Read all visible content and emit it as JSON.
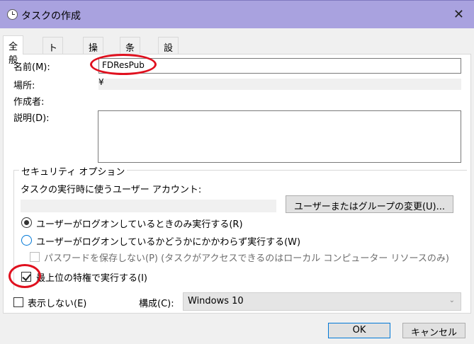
{
  "window": {
    "title": "タスクの作成",
    "close_icon": "close-icon",
    "app_icon": "clock-icon"
  },
  "tabs": [
    {
      "label": "全般"
    },
    {
      "label": "トリガー"
    },
    {
      "label": "操作"
    },
    {
      "label": "条件"
    },
    {
      "label": "設定"
    }
  ],
  "general": {
    "name_label": "名前(M):",
    "name_value": "FDResPub",
    "location_label": "場所:",
    "location_value": "¥",
    "author_label": "作成者:",
    "description_label": "説明(D):"
  },
  "security": {
    "group_title": "セキュリティ オプション",
    "account_label": "タスクの実行時に使うユーザー アカウント:",
    "change_user_button": "ユーザーまたはグループの変更(U)...",
    "radio_logged_on": "ユーザーがログオンしているときのみ実行する(R)",
    "radio_whether_logged_on": "ユーザーがログオンしているかどうかにかかわらず実行する(W)",
    "no_store_password": "パスワードを保存しない(P) (タスクがアクセスできるのはローカル コンピューター リソースのみ)",
    "run_highest": "最上位の特権で実行する(I)"
  },
  "bottom": {
    "hidden_label": "表示しない(E)",
    "configure_label": "構成(C):",
    "configure_value": "Windows 10",
    "ok_button": "OK",
    "cancel_button": "キャンセル"
  },
  "accent_colors": {
    "titlebar": "#a9a2df",
    "annotation": "#e0101e"
  }
}
